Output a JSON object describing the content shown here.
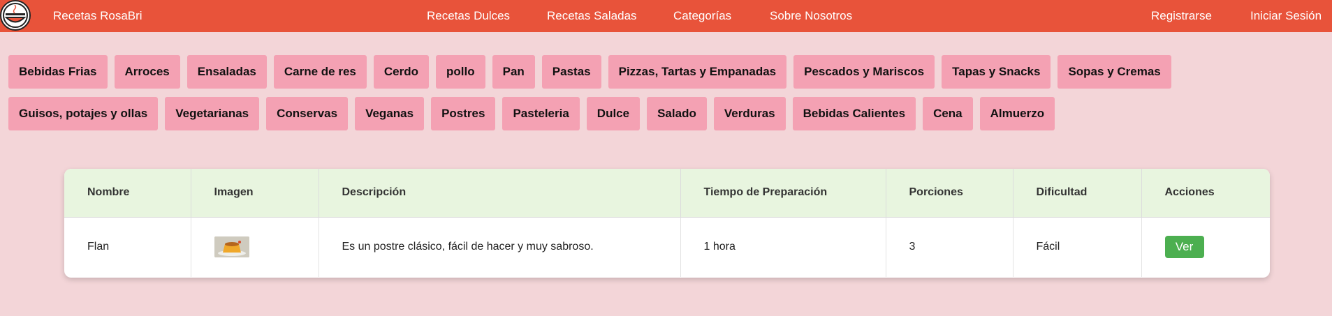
{
  "navbar": {
    "brand": "Recetas RosaBri",
    "links": [
      "Recetas Dulces",
      "Recetas Saladas",
      "Categorías",
      "Sobre Nosotros"
    ],
    "register": "Registrarse",
    "login": "Iniciar Sesión"
  },
  "categories": [
    "Bebidas Frias",
    "Arroces",
    "Ensaladas",
    "Carne de res",
    "Cerdo",
    "pollo",
    "Pan",
    "Pastas",
    "Pizzas, Tartas y Empanadas",
    "Pescados y Mariscos",
    "Tapas y Snacks",
    "Sopas y Cremas",
    "Guisos, potajes y ollas",
    "Vegetarianas",
    "Conservas",
    "Veganas",
    "Postres",
    "Pasteleria",
    "Dulce",
    "Salado",
    "Verduras",
    "Bebidas Calientes",
    "Cena",
    "Almuerzo"
  ],
  "table": {
    "headers": [
      "Nombre",
      "Imagen",
      "Descripción",
      "Tiempo de Preparación",
      "Porciones",
      "Dificultad",
      "Acciones"
    ],
    "rows": [
      {
        "nombre": "Flan",
        "imagen_icon": "flan-thumbnail",
        "descripcion": "Es un postre clásico, fácil de hacer y muy sabroso.",
        "tiempo": "1 hora",
        "porciones": "3",
        "dificultad": "Fácil",
        "accion": "Ver"
      }
    ]
  },
  "colors": {
    "navbar": "#e8533a",
    "background": "#f3d5d8",
    "category_button": "#f4a1b3",
    "table_header": "#e8f5df",
    "view_button": "#4caf50"
  }
}
